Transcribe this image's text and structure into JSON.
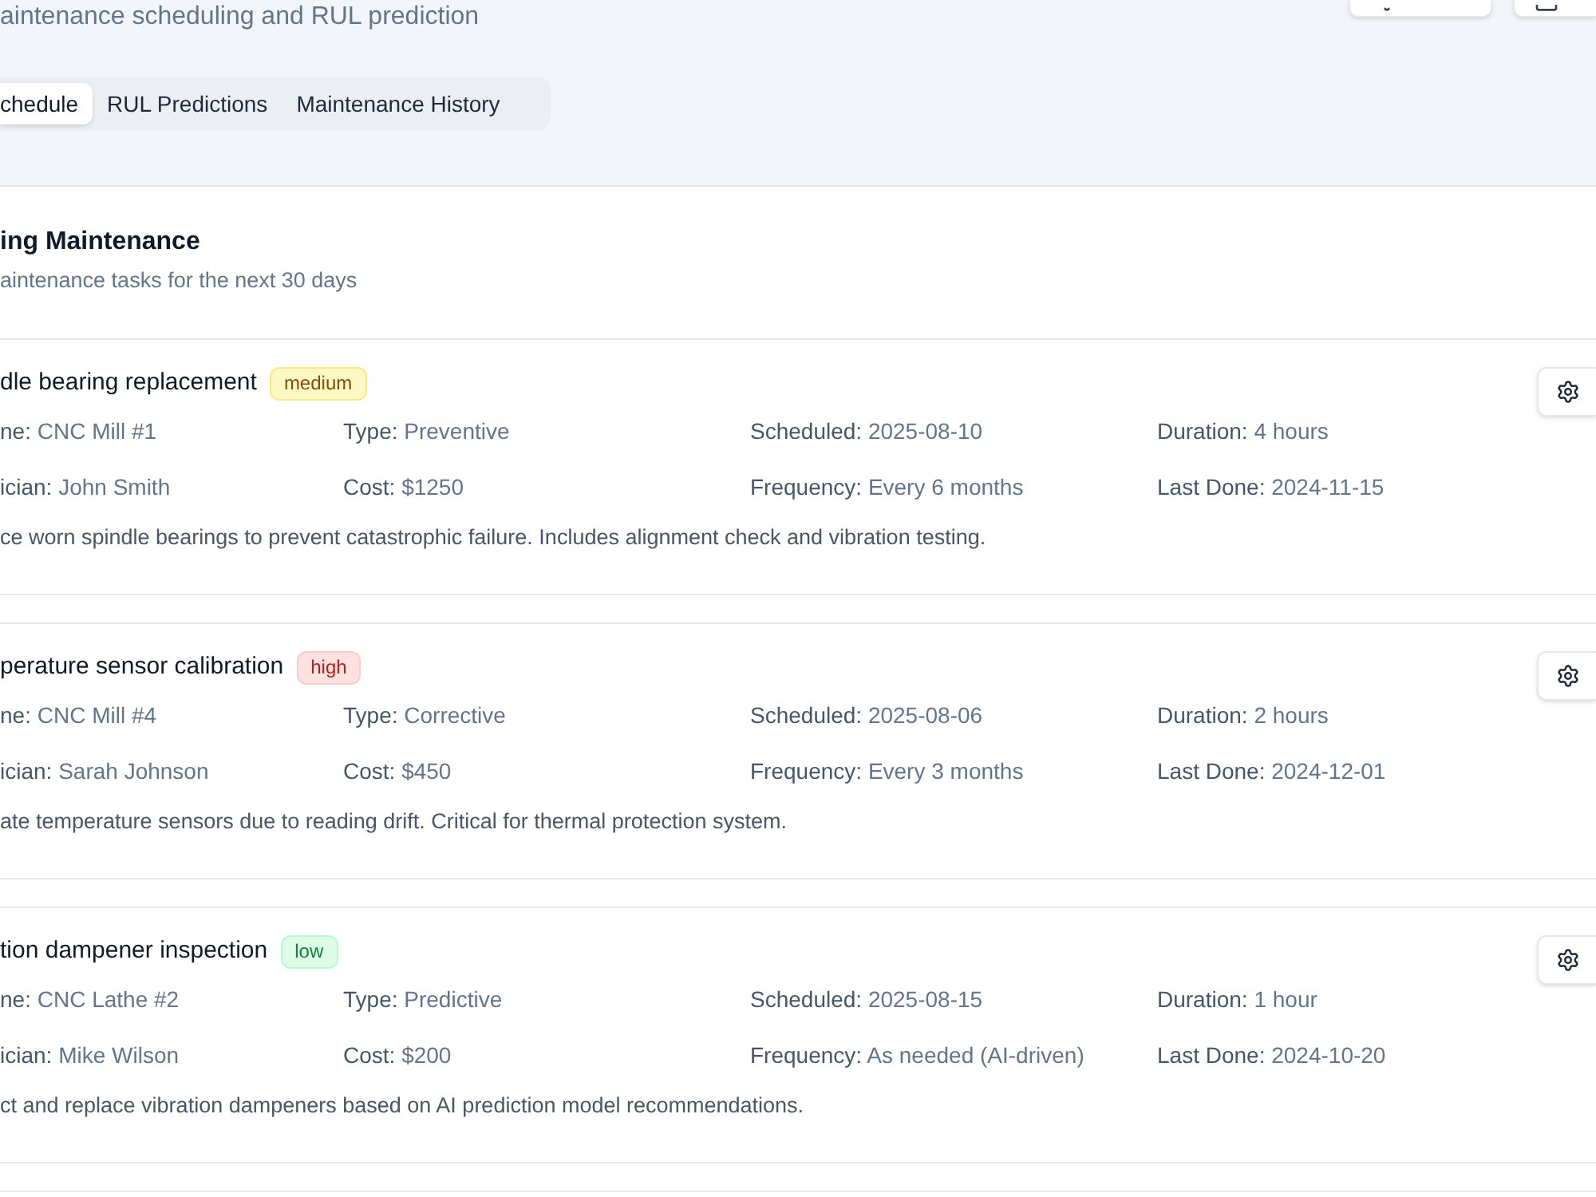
{
  "header": {
    "subtitle": "aintenance scheduling and RUL prediction"
  },
  "tabs": [
    {
      "label": "chedule",
      "selected": true
    },
    {
      "label": "RUL Predictions",
      "selected": false
    },
    {
      "label": "Maintenance History",
      "selected": false
    }
  ],
  "section": {
    "title": "ing Maintenance",
    "subtitle": "aintenance tasks for the next 30 days"
  },
  "tasks": [
    {
      "title": "dle bearing replacement",
      "priority": {
        "label": "medium",
        "kind": "medium"
      },
      "details": [
        {
          "label": "ne:",
          "value": "CNC Mill #1"
        },
        {
          "label": "Type:",
          "value": "Preventive"
        },
        {
          "label": "Scheduled:",
          "value": "2025-08-10"
        },
        {
          "label": "Duration:",
          "value": "4 hours"
        },
        {
          "label": "ician:",
          "value": "John Smith"
        },
        {
          "label": "Cost:",
          "value": "$1250"
        },
        {
          "label": "Frequency:",
          "value": "Every 6 months"
        },
        {
          "label": "Last Done:",
          "value": "2024-11-15"
        }
      ],
      "description": "ce worn spindle bearings to prevent catastrophic failure. Includes alignment check and vibration testing."
    },
    {
      "title": "perature sensor calibration",
      "priority": {
        "label": "high",
        "kind": "high"
      },
      "details": [
        {
          "label": "ne:",
          "value": "CNC Mill #4"
        },
        {
          "label": "Type:",
          "value": "Corrective"
        },
        {
          "label": "Scheduled:",
          "value": "2025-08-06"
        },
        {
          "label": "Duration:",
          "value": "2 hours"
        },
        {
          "label": "ician:",
          "value": "Sarah Johnson"
        },
        {
          "label": "Cost:",
          "value": "$450"
        },
        {
          "label": "Frequency:",
          "value": "Every 3 months"
        },
        {
          "label": "Last Done:",
          "value": "2024-12-01"
        }
      ],
      "description": "ate temperature sensors due to reading drift. Critical for thermal protection system."
    },
    {
      "title": "tion dampener inspection",
      "priority": {
        "label": "low",
        "kind": "low"
      },
      "details": [
        {
          "label": "ne:",
          "value": "CNC Lathe #2"
        },
        {
          "label": "Type:",
          "value": "Predictive"
        },
        {
          "label": "Scheduled:",
          "value": "2025-08-15"
        },
        {
          "label": "Duration:",
          "value": "1 hour"
        },
        {
          "label": "ician:",
          "value": "Mike Wilson"
        },
        {
          "label": "Cost:",
          "value": "$200"
        },
        {
          "label": "Frequency:",
          "value": "As needed (AI-driven)"
        },
        {
          "label": "Last Done:",
          "value": "2024-10-20"
        }
      ],
      "description": "ct and replace vibration dampeners based on AI prediction model recommendations."
    }
  ]
}
